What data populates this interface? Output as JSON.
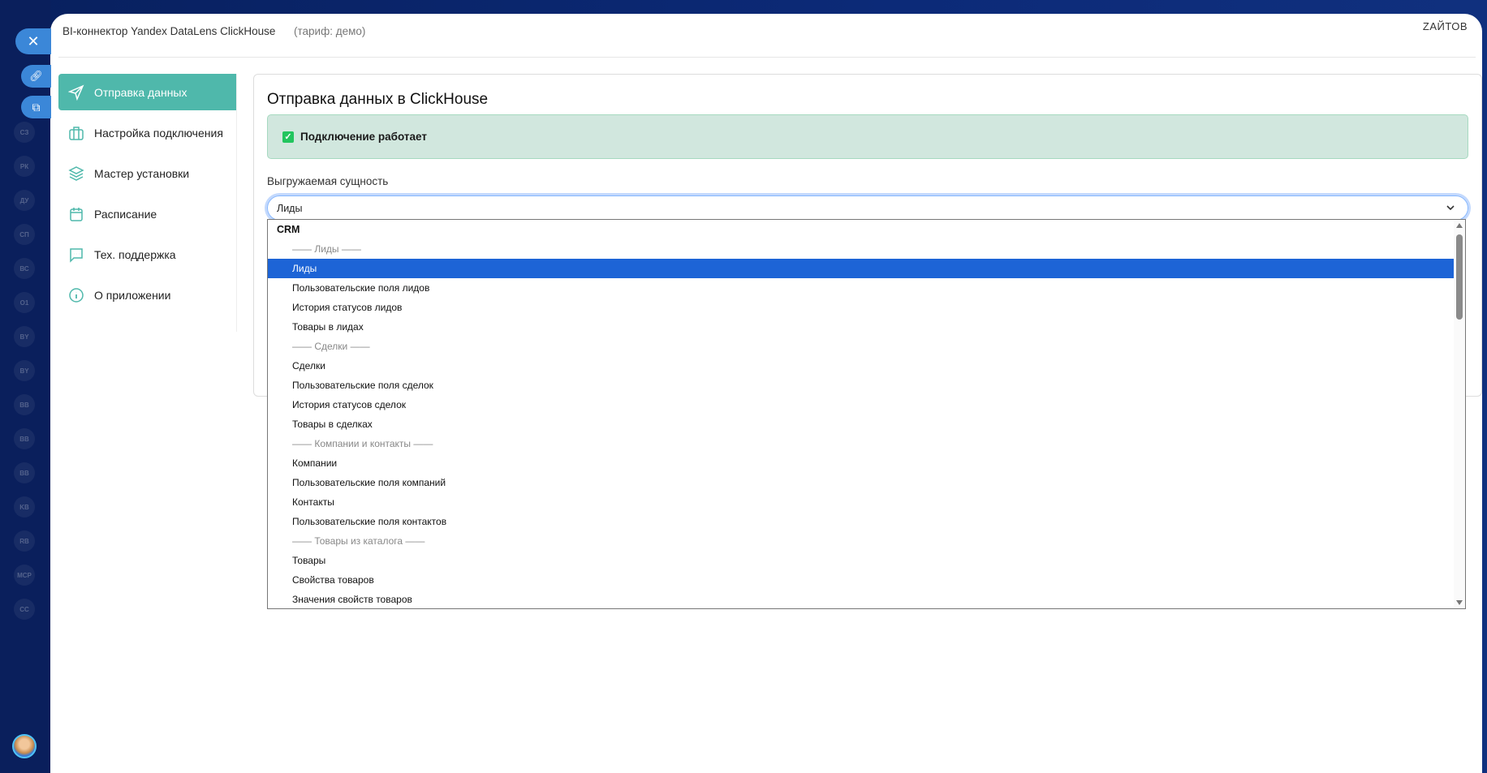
{
  "background": {
    "sidebar_badges": [
      "СЗ",
      "РК",
      "ДУ",
      "СП",
      "ВС",
      "О1",
      "BY",
      "BY",
      "BB",
      "BB",
      "BB",
      "KB",
      "RB",
      "MCP",
      "CC"
    ]
  },
  "header": {
    "title": "BI-коннектор Yandex DataLens ClickHouse",
    "tariff": "(тариф: демо)",
    "logo": "ZАЙТОВ"
  },
  "nav": {
    "items": [
      {
        "label": "Отправка данных",
        "icon": "send-icon"
      },
      {
        "label": "Настройка подключения",
        "icon": "briefcase-icon"
      },
      {
        "label": "Мастер установки",
        "icon": "layers-icon"
      },
      {
        "label": "Расписание",
        "icon": "calendar-icon"
      },
      {
        "label": "Тех. поддержка",
        "icon": "chat-icon"
      },
      {
        "label": "О приложении",
        "icon": "info-icon"
      }
    ]
  },
  "main": {
    "title": "Отправка данных в ClickHouse",
    "status": "Подключение работает",
    "entity_label": "Выгружаемая сущность",
    "entity_value": "Лиды",
    "options": [
      {
        "t": "CRM",
        "k": "group"
      },
      {
        "t": "—— Лиды ——",
        "k": "sep"
      },
      {
        "t": "Лиды",
        "k": "sel"
      },
      {
        "t": "Пользовательские поля лидов"
      },
      {
        "t": "История статусов лидов"
      },
      {
        "t": "Товары в лидах"
      },
      {
        "t": "—— Сделки ——",
        "k": "sep"
      },
      {
        "t": "Сделки"
      },
      {
        "t": "Пользовательские поля сделок"
      },
      {
        "t": "История статусов сделок"
      },
      {
        "t": "Товары в сделках"
      },
      {
        "t": "—— Компании и контакты ——",
        "k": "sep"
      },
      {
        "t": "Компании"
      },
      {
        "t": "Пользовательские поля компаний"
      },
      {
        "t": "Контакты"
      },
      {
        "t": "Пользовательские поля контактов"
      },
      {
        "t": "—— Товары из каталога ——",
        "k": "sep"
      },
      {
        "t": "Товары"
      },
      {
        "t": "Свойства товаров"
      },
      {
        "t": "Значения свойств товаров"
      }
    ]
  },
  "colors": {
    "accent": "#4fb8ab",
    "selected": "#1d64d6",
    "success_bg": "#d1e7de"
  }
}
